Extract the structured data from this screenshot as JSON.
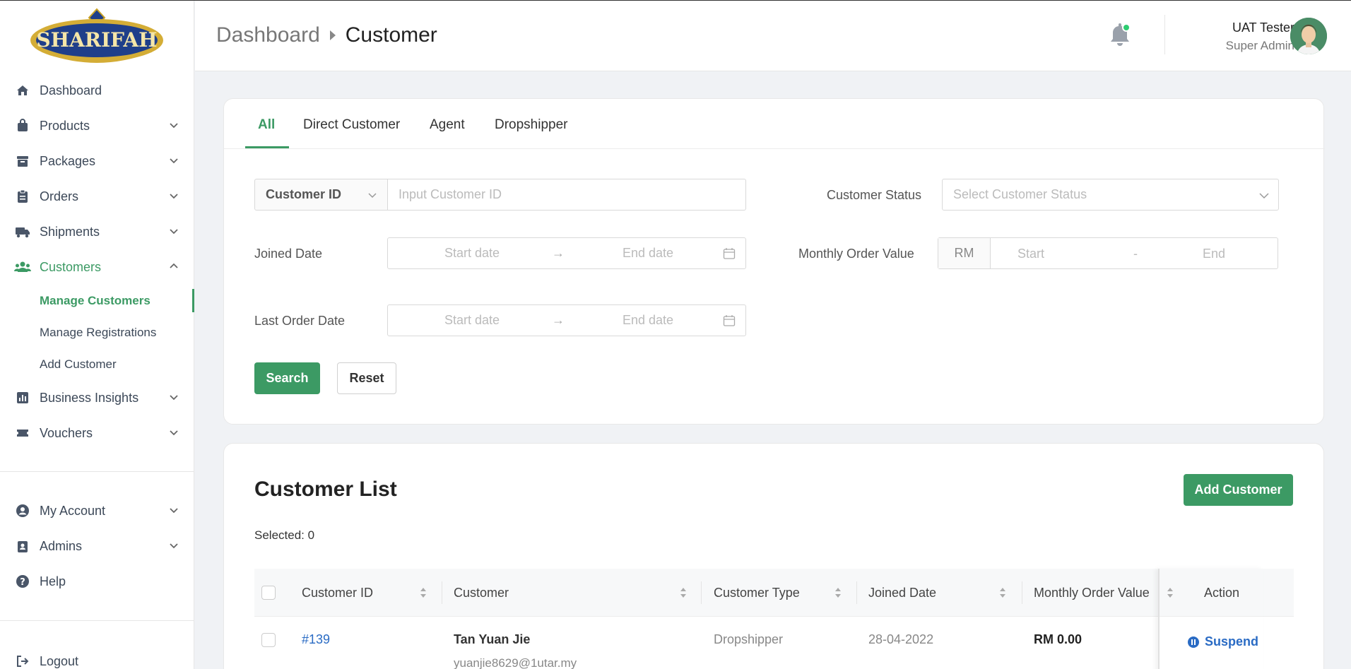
{
  "brand": {
    "logo_text": "SHARIFAH",
    "accent": "#3c9a64",
    "link_color": "#2a6bc4"
  },
  "sidebar": {
    "items": [
      {
        "label": "Dashboard",
        "icon": "home-icon",
        "expandable": false
      },
      {
        "label": "Products",
        "icon": "bag-icon",
        "expandable": true
      },
      {
        "label": "Packages",
        "icon": "archive-icon",
        "expandable": true
      },
      {
        "label": "Orders",
        "icon": "clipboard-icon",
        "expandable": true
      },
      {
        "label": "Shipments",
        "icon": "truck-icon",
        "expandable": true
      },
      {
        "label": "Customers",
        "icon": "users-icon",
        "expandable": true,
        "expanded": true,
        "active": true
      },
      {
        "label": "Business Insights",
        "icon": "chart-icon",
        "expandable": true
      },
      {
        "label": "Vouchers",
        "icon": "ticket-icon",
        "expandable": true
      }
    ],
    "customers_sub": [
      {
        "label": "Manage Customers",
        "active": true
      },
      {
        "label": "Manage Registrations"
      },
      {
        "label": "Add Customer"
      }
    ],
    "bottom_items": [
      {
        "label": "My Account",
        "icon": "user-circle-icon"
      },
      {
        "label": "Admins",
        "icon": "badge-icon"
      },
      {
        "label": "Help",
        "icon": "help-icon"
      }
    ],
    "logout": "Logout"
  },
  "header": {
    "breadcrumb": [
      "Dashboard",
      "Customer"
    ],
    "notification_dot": true,
    "user_name": "UAT Tester",
    "user_role": "Super Admin"
  },
  "filters": {
    "tabs": [
      "All",
      "Direct Customer",
      "Agent",
      "Dropshipper"
    ],
    "active_tab": "All",
    "id_selector": "Customer ID",
    "id_placeholder": "Input Customer ID",
    "status_label": "Customer Status",
    "status_placeholder": "Select Customer Status",
    "joined_label": "Joined Date",
    "monthly_label": "Monthly Order Value",
    "last_order_label": "Last Order Date",
    "start_date": "Start date",
    "end_date": "End date",
    "currency": "RM",
    "start": "Start",
    "end": "End",
    "range_sep": "-",
    "date_arrow": "→",
    "search_btn": "Search",
    "reset_btn": "Reset"
  },
  "list": {
    "title": "Customer List",
    "add_btn": "Add Customer",
    "selected": "Selected: 0",
    "columns": [
      "Customer ID",
      "Customer",
      "Customer Type",
      "Joined Date",
      "Monthly Order Value",
      "Action"
    ],
    "rows": [
      {
        "id": "#139",
        "name": "Tan Yuan Jie",
        "email": "yuanjie8629@1utar.my",
        "type": "Dropshipper",
        "joined": "28-04-2022",
        "monthly": "RM 0.00",
        "action": "Suspend"
      }
    ]
  }
}
